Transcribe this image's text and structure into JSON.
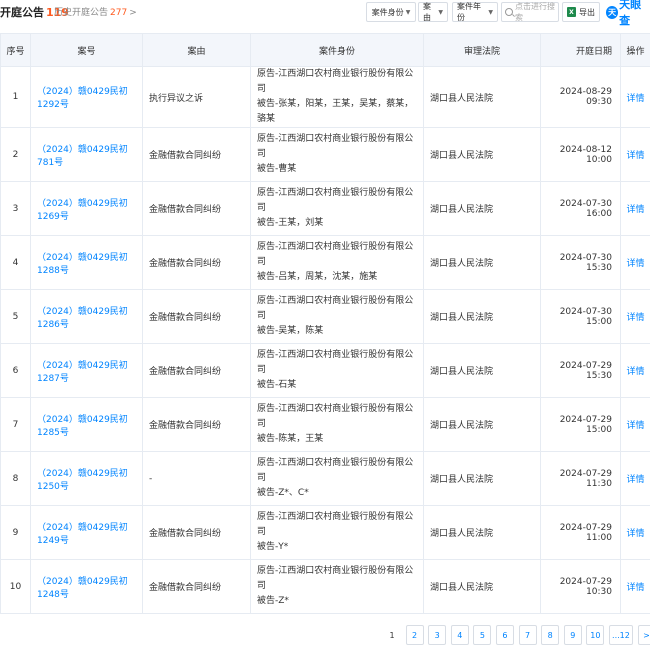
{
  "header": {
    "title": "开庭公告",
    "count": "119",
    "history_label": "历史开庭公告",
    "history_count": "277",
    "history_chevron": ">",
    "filters": [
      "案件身份",
      "案由",
      "案件年份"
    ],
    "search_placeholder": "点击进行搜索",
    "export_label": "导出",
    "logo_text": "天眼查"
  },
  "table": {
    "columns": [
      "序号",
      "案号",
      "案由",
      "案件身份",
      "审理法院",
      "开庭日期",
      "操作"
    ],
    "rows": [
      {
        "no": "1",
        "case": "（2024）赣0429民初1292号",
        "cause": "执行异议之诉",
        "plaintiff": "原告-江西湖口农村商业银行股份有限公司",
        "defendant": "被告-张某，阳某，王某，吴某，蔡某，骆某",
        "court": "湖口县人民法院",
        "date": "2024-08-29 09:30",
        "op": "详情"
      },
      {
        "no": "2",
        "case": "（2024）赣0429民初781号",
        "cause": "金融借款合同纠纷",
        "plaintiff": "原告-江西湖口农村商业银行股份有限公司",
        "defendant": "被告-曹某",
        "court": "湖口县人民法院",
        "date": "2024-08-12 10:00",
        "op": "详情"
      },
      {
        "no": "3",
        "case": "（2024）赣0429民初1269号",
        "cause": "金融借款合同纠纷",
        "plaintiff": "原告-江西湖口农村商业银行股份有限公司",
        "defendant": "被告-王某，刘某",
        "court": "湖口县人民法院",
        "date": "2024-07-30 16:00",
        "op": "详情"
      },
      {
        "no": "4",
        "case": "（2024）赣0429民初1288号",
        "cause": "金融借款合同纠纷",
        "plaintiff": "原告-江西湖口农村商业银行股份有限公司",
        "defendant": "被告-吕某，周某，沈某，施某",
        "court": "湖口县人民法院",
        "date": "2024-07-30 15:30",
        "op": "详情"
      },
      {
        "no": "5",
        "case": "（2024）赣0429民初1286号",
        "cause": "金融借款合同纠纷",
        "plaintiff": "原告-江西湖口农村商业银行股份有限公司",
        "defendant": "被告-吴某，陈某",
        "court": "湖口县人民法院",
        "date": "2024-07-30 15:00",
        "op": "详情"
      },
      {
        "no": "6",
        "case": "（2024）赣0429民初1287号",
        "cause": "金融借款合同纠纷",
        "plaintiff": "原告-江西湖口农村商业银行股份有限公司",
        "defendant": "被告-石某",
        "court": "湖口县人民法院",
        "date": "2024-07-29 15:30",
        "op": "详情"
      },
      {
        "no": "7",
        "case": "（2024）赣0429民初1285号",
        "cause": "金融借款合同纠纷",
        "plaintiff": "原告-江西湖口农村商业银行股份有限公司",
        "defendant": "被告-陈某，王某",
        "court": "湖口县人民法院",
        "date": "2024-07-29 15:00",
        "op": "详情"
      },
      {
        "no": "8",
        "case": "（2024）赣0429民初1250号",
        "cause": "-",
        "plaintiff": "原告-江西湖口农村商业银行股份有限公司",
        "defendant": "被告-Z*、C*",
        "court": "湖口县人民法院",
        "date": "2024-07-29 11:30",
        "op": "详情"
      },
      {
        "no": "9",
        "case": "（2024）赣0429民初1249号",
        "cause": "金融借款合同纠纷",
        "plaintiff": "原告-江西湖口农村商业银行股份有限公司",
        "defendant": "被告-Y*",
        "court": "湖口县人民法院",
        "date": "2024-07-29 11:00",
        "op": "详情"
      },
      {
        "no": "10",
        "case": "（2024）赣0429民初1248号",
        "cause": "金融借款合同纠纷",
        "plaintiff": "原告-江西湖口农村商业银行股份有限公司",
        "defendant": "被告-Z*",
        "court": "湖口县人民法院",
        "date": "2024-07-29 10:30",
        "op": "详情"
      }
    ]
  },
  "pagination": {
    "pages": [
      "1",
      "2",
      "3",
      "4",
      "5",
      "6",
      "7",
      "8",
      "9",
      "10",
      "...12"
    ],
    "current": "1",
    "next": ">"
  },
  "icons": {
    "search": "search-icon",
    "export": "excel-icon",
    "logo": "tianyancha-logo-icon"
  },
  "colors": {
    "accent": "#0084ff",
    "count": "#ff5a1f",
    "header_bg": "#f3f6fb",
    "excel": "#1e8a4c"
  }
}
